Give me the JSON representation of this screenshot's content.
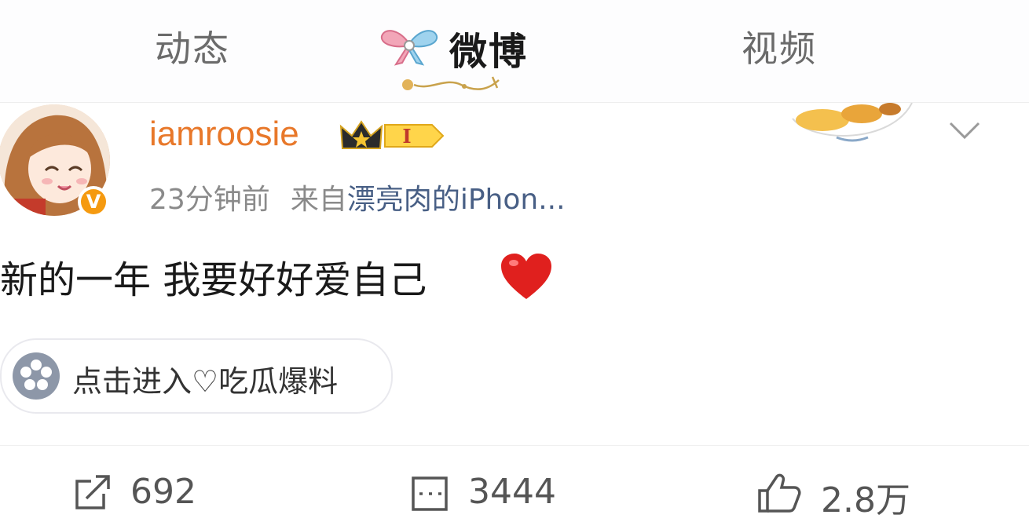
{
  "tabs": {
    "dynamic": "动态",
    "weibo": "微博",
    "video": "视频"
  },
  "post": {
    "username": "iamroosie",
    "member_level": "I",
    "time": "23分钟前",
    "source_prefix": "来自",
    "source_device": "漂亮肉的iPhon...",
    "text": "新的一年 我要好好爱自己",
    "verified_badge": "V",
    "topic": {
      "label": "点击进入♡吃瓜爆料",
      "icon": "flower-icon"
    },
    "actions": {
      "repost_count": "692",
      "comment_count": "3444",
      "like_count": "2.8万"
    }
  },
  "colors": {
    "username": "#e8782a",
    "source_link": "#485f85",
    "verified": "#f59a10",
    "heart": "#e0201e"
  }
}
